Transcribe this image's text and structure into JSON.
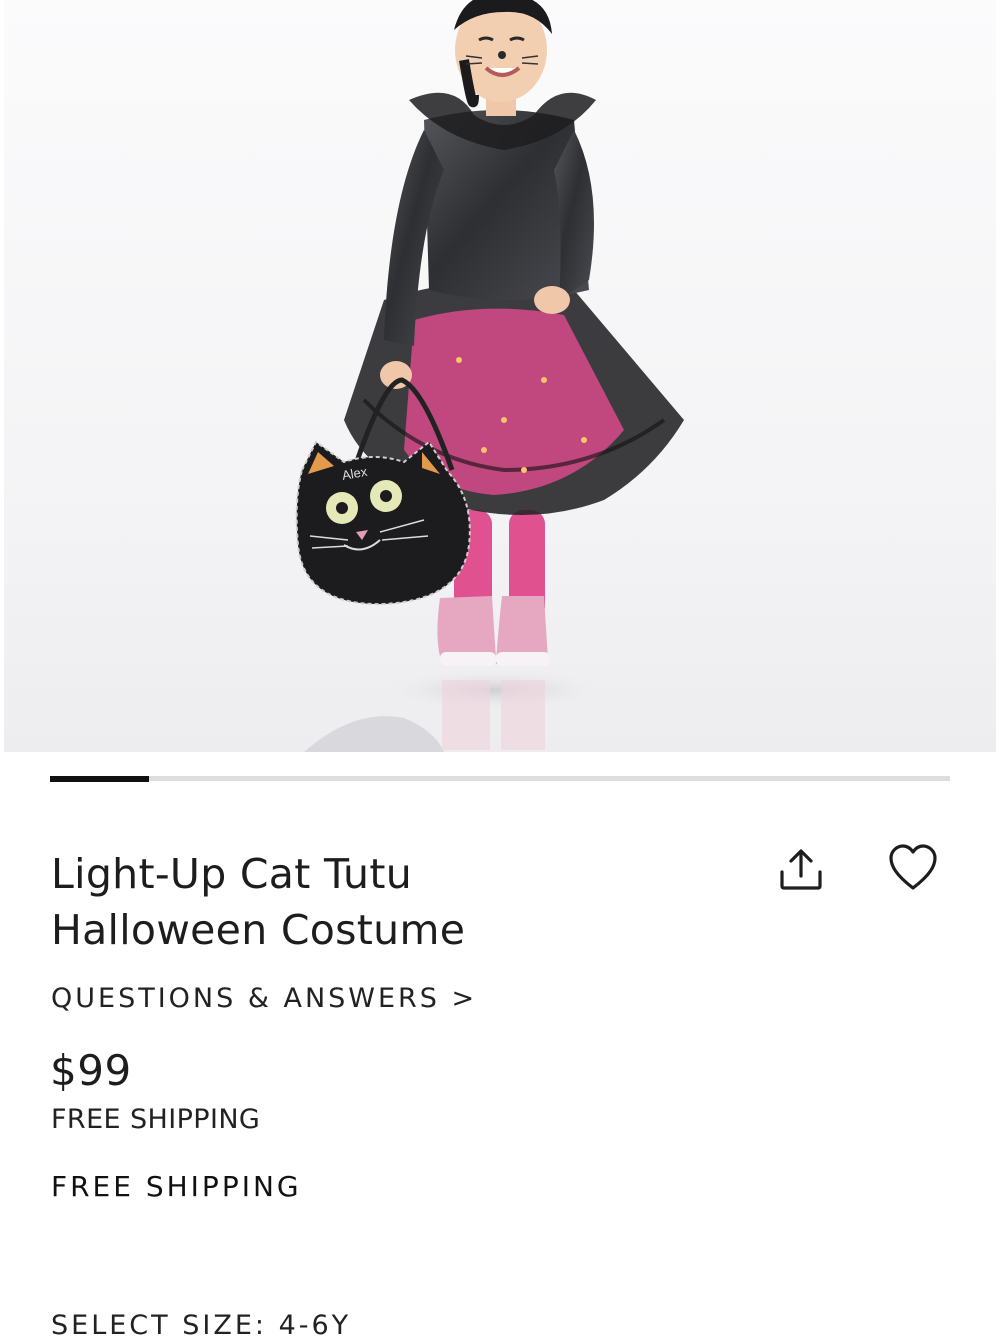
{
  "product": {
    "image_alt": "Child wearing a light-up cat tutu costume holding a cat-face treat bag",
    "bag_name": "Alex",
    "title_line1": "Light-Up Cat Tutu",
    "title_line2": "Halloween Costume",
    "qa_link": "QUESTIONS & ANSWERS >",
    "price": "$99",
    "shipping_note": "FREE SHIPPING",
    "shipping_banner": "FREE SHIPPING",
    "size_label": "SELECT SIZE: 4-6Y"
  },
  "gallery": {
    "progress_fraction": 0.11
  },
  "icons": {
    "share": "share-upload-icon",
    "favorite": "heart-outline-icon"
  },
  "colors": {
    "text": "#1d1d1d",
    "progress_fill": "#111111",
    "progress_track": "#dddddd",
    "tutu_pink": "#e0528f"
  }
}
